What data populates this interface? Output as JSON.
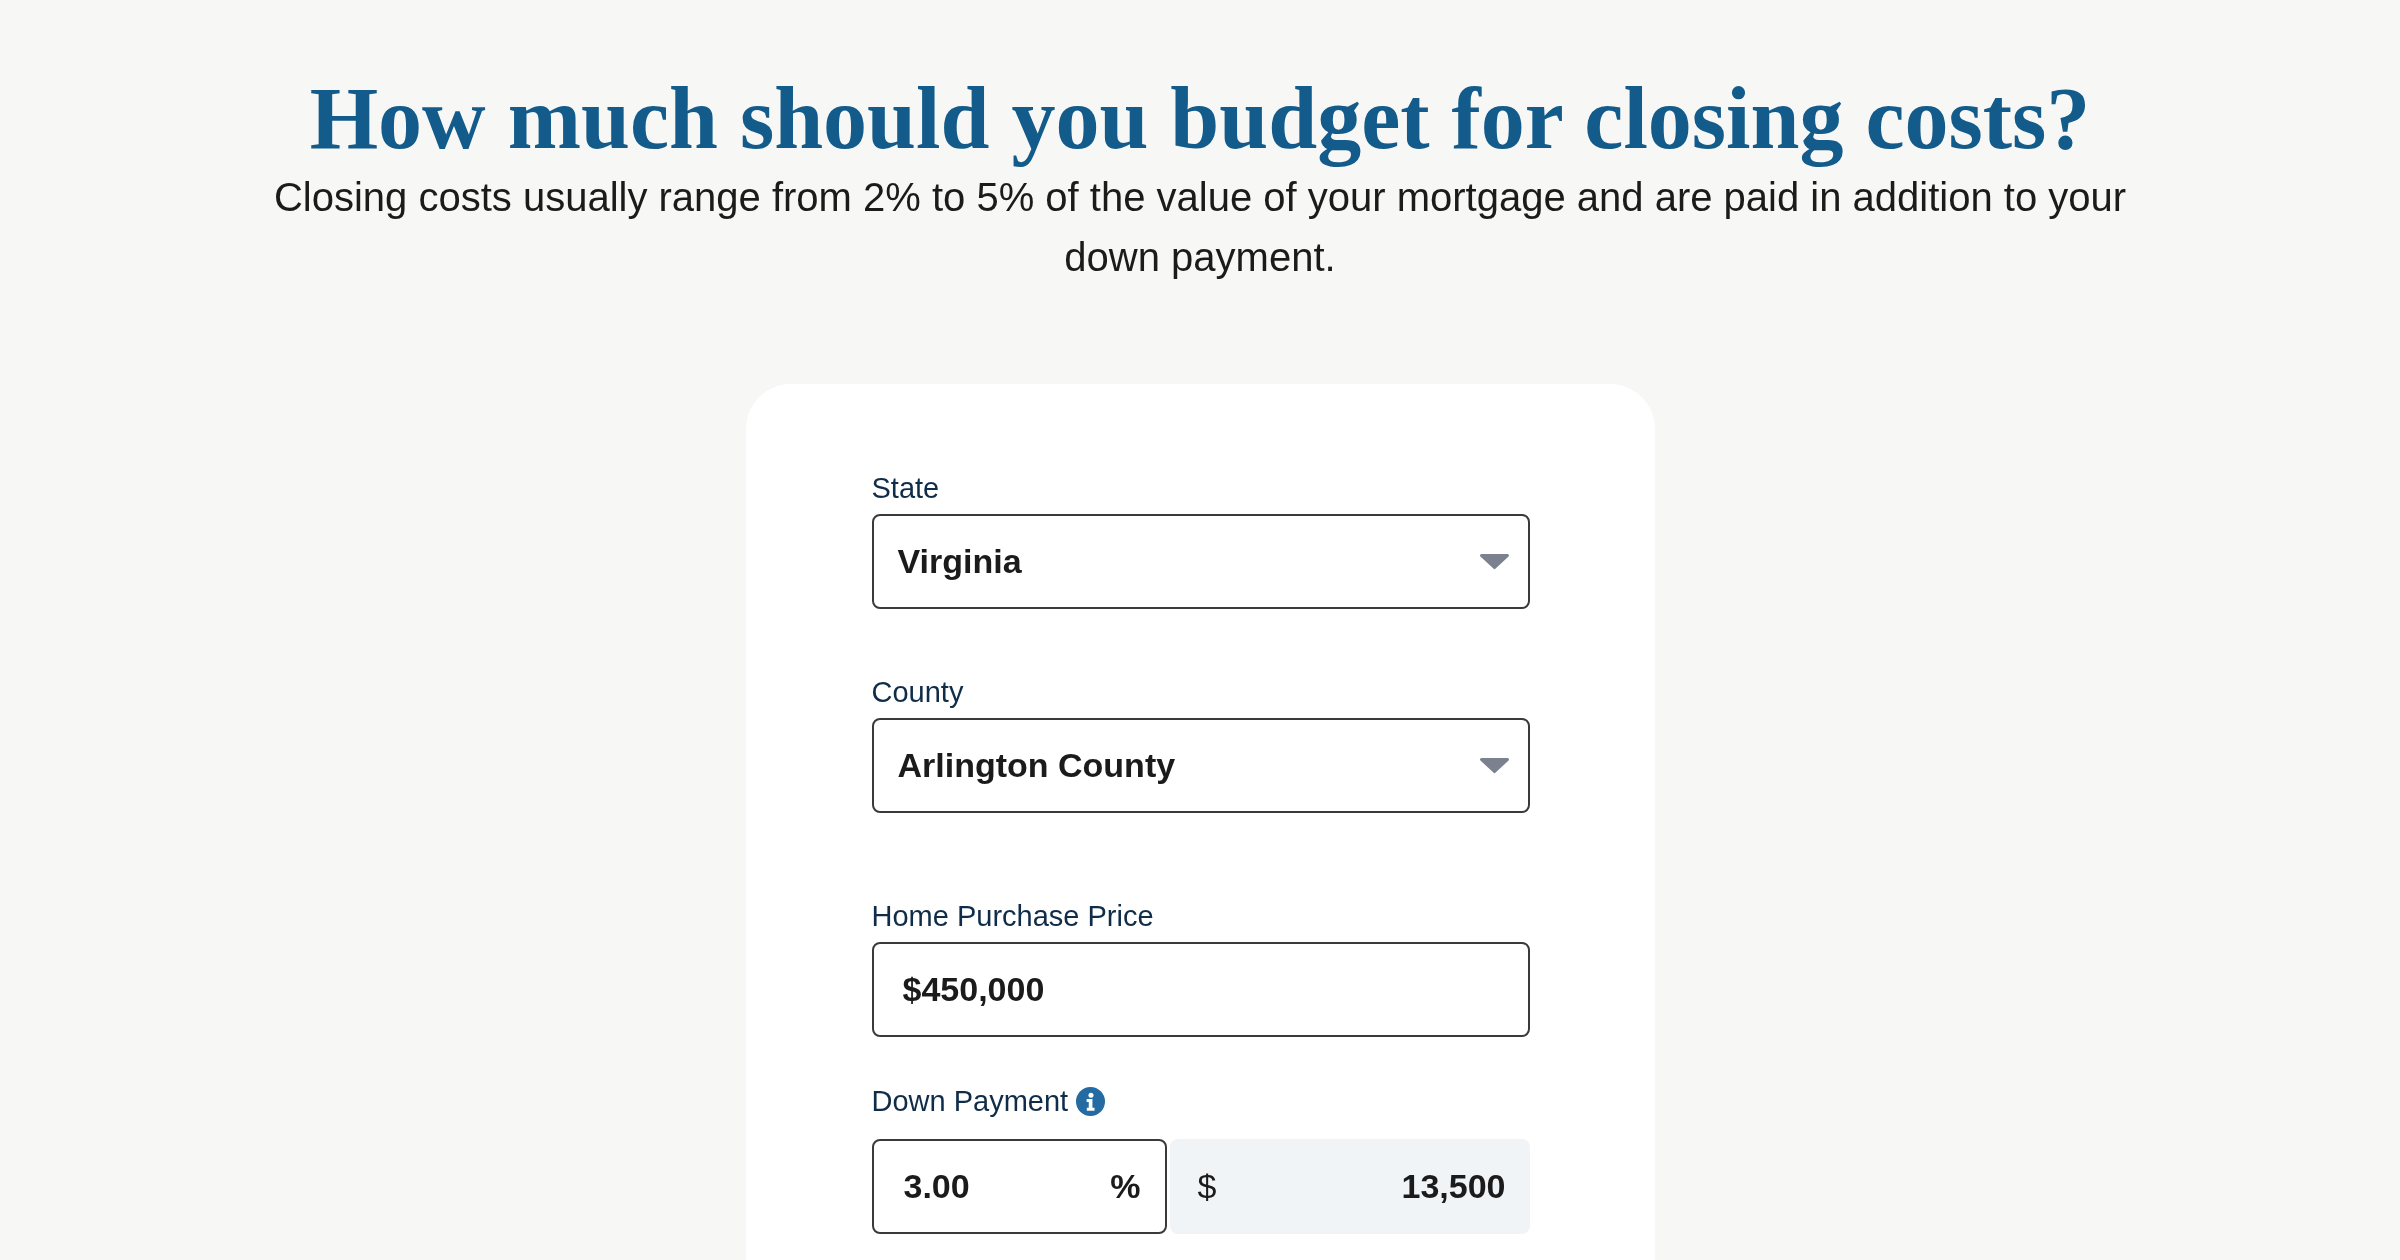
{
  "heading": "How much should you budget for closing costs?",
  "intro": "Closing costs usually range from 2% to 5% of the value of your mortgage and are paid in addition to your down payment.",
  "form": {
    "fields": [
      {
        "kind": "select",
        "label": "State",
        "value": "Virginia"
      },
      {
        "kind": "select",
        "label": "County",
        "value": "Arlington County"
      },
      {
        "kind": "text",
        "label": "Home Purchase Price",
        "value": "$450,000"
      },
      {
        "kind": "split",
        "label": "Down Payment",
        "info": true,
        "percent": {
          "value": "3.00",
          "unit": "%"
        },
        "amount": {
          "prefix": "$",
          "value": "13,500"
        }
      }
    ]
  }
}
